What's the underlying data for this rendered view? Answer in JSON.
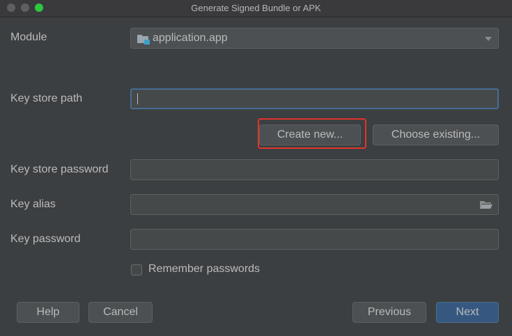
{
  "window": {
    "title": "Generate Signed Bundle or APK"
  },
  "form": {
    "module_label": "Module",
    "module_value": "application.app",
    "keystore_path_label": "Key store path",
    "keystore_path_value": "",
    "create_new_label": "Create new...",
    "choose_existing_label": "Choose existing...",
    "keystore_password_label": "Key store password",
    "key_alias_label": "Key alias",
    "key_password_label": "Key password",
    "remember_label": "Remember passwords",
    "remember_checked": false
  },
  "footer": {
    "help_label": "Help",
    "cancel_label": "Cancel",
    "previous_label": "Previous",
    "next_label": "Next"
  },
  "colors": {
    "background": "#3c3f41",
    "field_background": "#45494a",
    "focus_border": "#466d94",
    "primary_button": "#365880",
    "highlight": "#e0352b",
    "module_icon_accent": "#40a0c8"
  }
}
